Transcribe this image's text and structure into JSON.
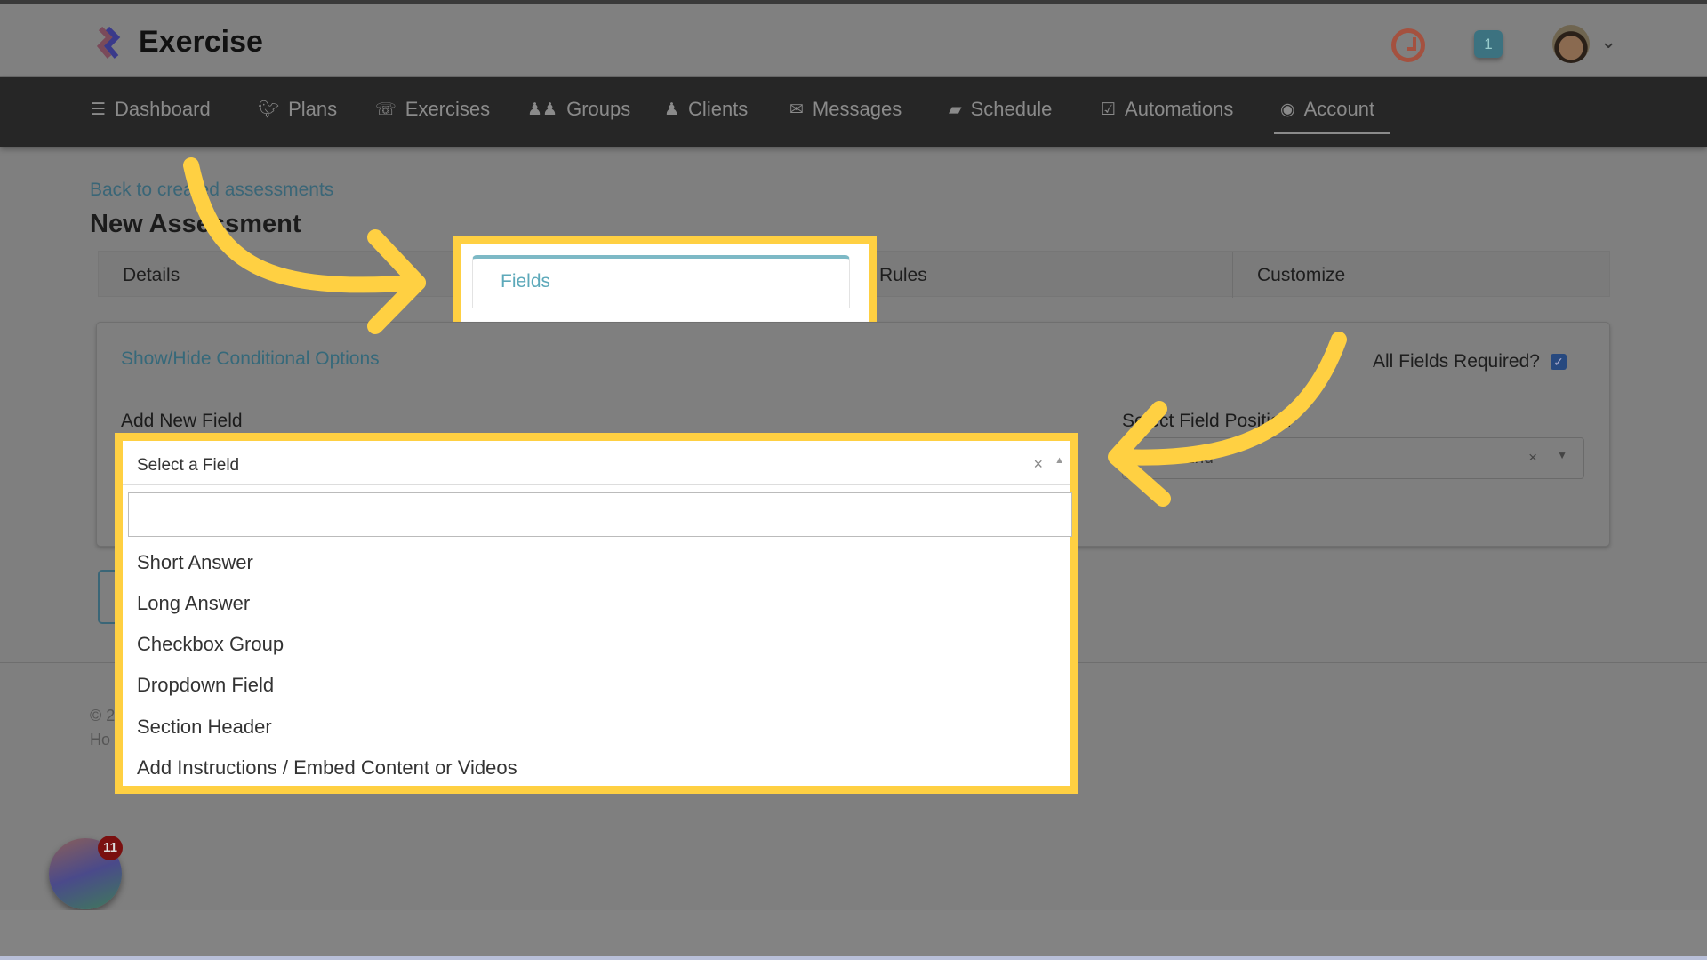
{
  "app": {
    "name": "Exercise",
    "notification_count": "1",
    "avatar_alt": "user avatar"
  },
  "nav": {
    "items": [
      {
        "label": "Dashboard",
        "icon": "list-icon"
      },
      {
        "label": "Plans",
        "icon": "twitter-bird-icon"
      },
      {
        "label": "Exercises",
        "icon": "phone-icon"
      },
      {
        "label": "Groups",
        "icon": "users-icon"
      },
      {
        "label": "Clients",
        "icon": "user-icon"
      },
      {
        "label": "Messages",
        "icon": "envelope-icon"
      },
      {
        "label": "Schedule",
        "icon": "book-icon"
      },
      {
        "label": "Automations",
        "icon": "check-square-icon"
      },
      {
        "label": "Account",
        "icon": "user-circle-icon",
        "active": true
      }
    ]
  },
  "page": {
    "back_link": "Back to created assessments",
    "title": "New Assessment"
  },
  "tabs": [
    {
      "label": "Details"
    },
    {
      "label": "Fields",
      "active": true
    },
    {
      "label": "Rules"
    },
    {
      "label": "Customize"
    }
  ],
  "form": {
    "show_hide": "Show/Hide Conditional Options",
    "all_required_label": "All Fields Required?",
    "all_required_checked": true,
    "add_field_label": "Add New Field",
    "position_label": "Select Field Position",
    "position_value": "End",
    "select_placeholder": "Select a Field",
    "search_value": "",
    "options": [
      "Short Answer",
      "Long Answer",
      "Checkbox Group",
      "Dropdown Field",
      "Section Header",
      "Add Instructions / Embed Content or Videos"
    ]
  },
  "footer": {
    "line1": "© 2",
    "line2": "Ho"
  },
  "chat": {
    "badge": "11"
  },
  "colors": {
    "highlight": "#ffd042",
    "accent": "#5da9ba",
    "nav_bg": "#262626"
  }
}
